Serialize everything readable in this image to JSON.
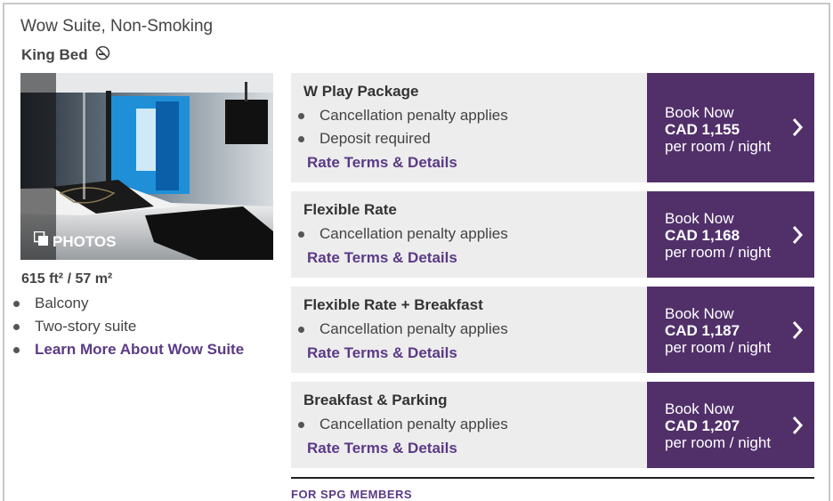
{
  "room": {
    "title": "Wow Suite, Non-Smoking",
    "bed": "King Bed",
    "photo_label": "PHOTOS",
    "size": "615 ft² / 57 m²",
    "features": [
      "Balcony",
      "Two-story suite"
    ],
    "learn_more": "Learn More About Wow Suite"
  },
  "rates": [
    {
      "name": "W Play Package",
      "bullets": [
        "Cancellation penalty applies",
        "Deposit required"
      ],
      "terms": "Rate Terms & Details",
      "book_label": "Book Now",
      "price": "CAD 1,155",
      "unit": "per room / night"
    },
    {
      "name": "Flexible Rate",
      "bullets": [
        "Cancellation penalty applies"
      ],
      "terms": "Rate Terms & Details",
      "book_label": "Book Now",
      "price": "CAD 1,168",
      "unit": "per room / night"
    },
    {
      "name": "Flexible Rate + Breakfast",
      "bullets": [
        "Cancellation penalty applies"
      ],
      "terms": "Rate Terms & Details",
      "book_label": "Book Now",
      "price": "CAD 1,187",
      "unit": "per room / night"
    },
    {
      "name": "Breakfast & Parking",
      "bullets": [
        "Cancellation penalty applies"
      ],
      "terms": "Rate Terms & Details",
      "book_label": "Book Now",
      "price": "CAD 1,207",
      "unit": "per room / night"
    }
  ],
  "members_heading": "FOR SPG MEMBERS",
  "colors": {
    "accent": "#51306a",
    "link": "#5b3a86",
    "panel": "#ededed"
  },
  "icons": {
    "no_smoking": "no-smoking-icon",
    "photos": "photos-gallery-icon",
    "book_arrow": "chevron-right-icon"
  }
}
